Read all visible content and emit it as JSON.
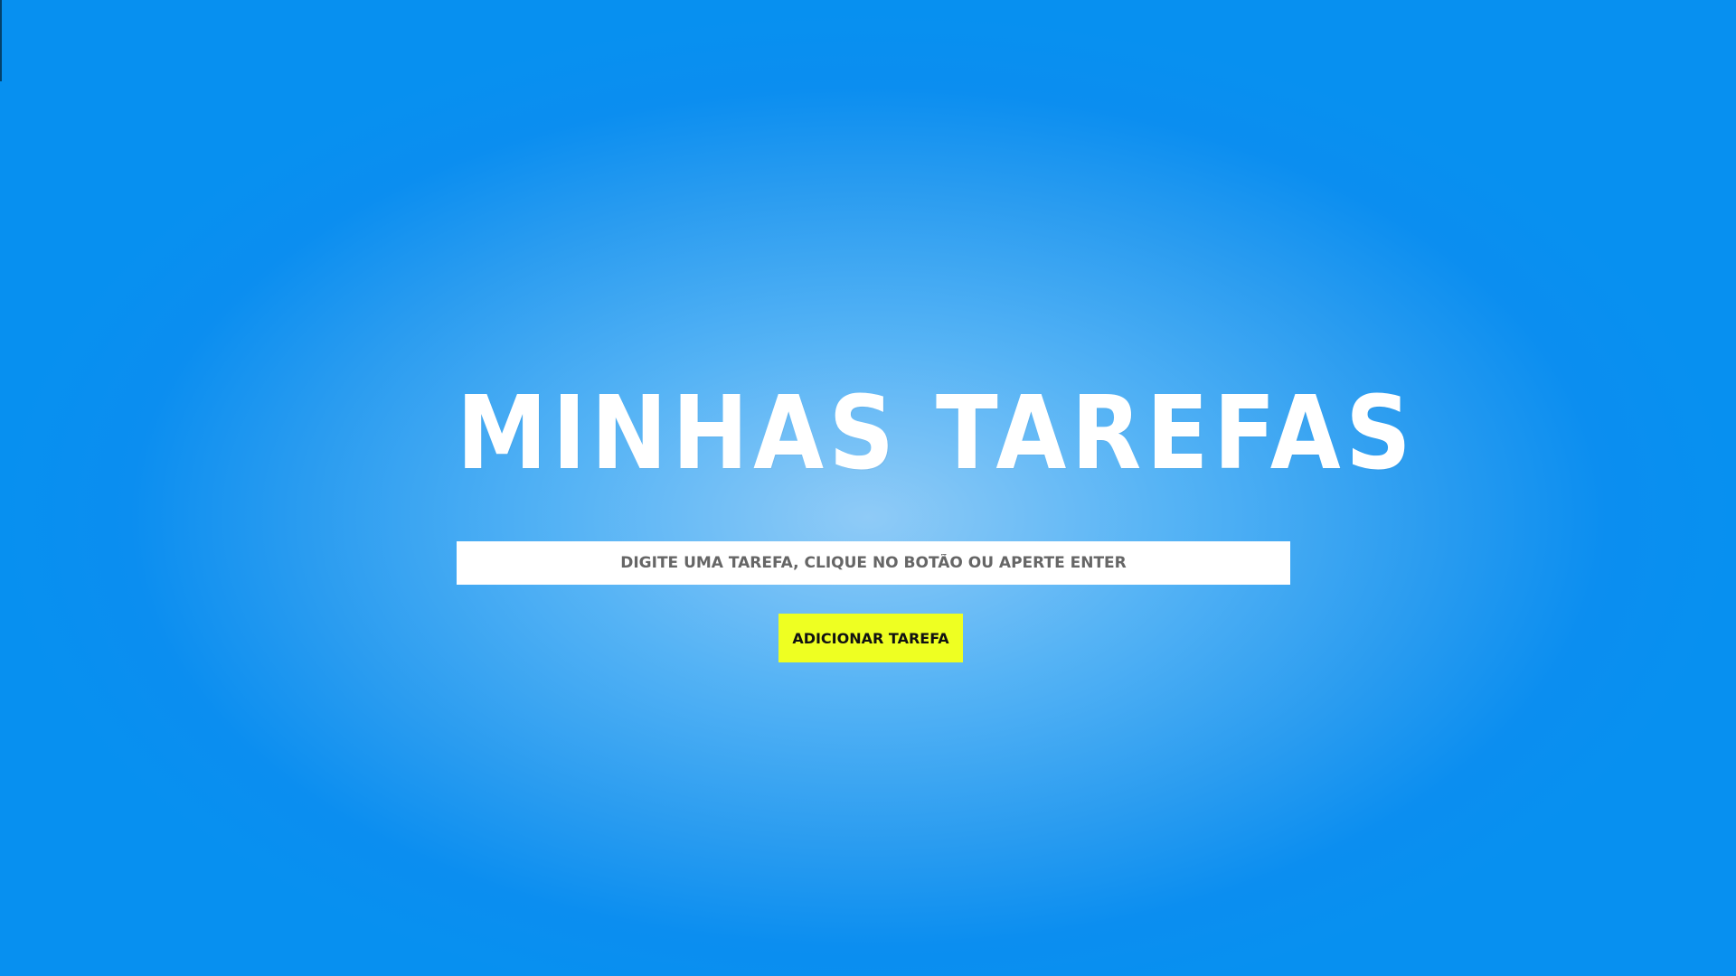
{
  "app": {
    "title": "Minhas Tarefas"
  },
  "task_form": {
    "input_value": "",
    "input_placeholder": "Digite uma tarefa, clique no botão ou aperte enter",
    "add_button_label": "Adicionar tarefa"
  },
  "colors": {
    "background_center": "#8fcbf7",
    "background_edge": "#0790f0",
    "title_text": "#ffffff",
    "input_background": "#ffffff",
    "placeholder_text": "#666666",
    "button_background": "#eeff22",
    "button_text": "#111111"
  }
}
